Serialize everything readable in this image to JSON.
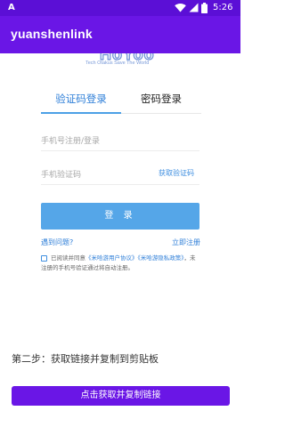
{
  "status_bar": {
    "time": "5:26",
    "left_icon": "A",
    "icons": [
      "wifi-icon",
      "signal-icon",
      "battery-icon"
    ]
  },
  "app_bar": {
    "title": "yuanshenlink"
  },
  "logo": {
    "mark": "HoYoo",
    "tagline": "Tech Otakus Save The World"
  },
  "tabs": [
    {
      "label": "验证码登录",
      "active": true
    },
    {
      "label": "密码登录",
      "active": false
    }
  ],
  "form": {
    "phone_placeholder": "手机号注册/登录",
    "code_placeholder": "手机验证码",
    "get_code_label": "获取验证码",
    "login_label": "登 录"
  },
  "links": {
    "help": "遇到问题?",
    "register": "立即注册"
  },
  "agreement": {
    "prefix": "已阅读并同意",
    "terms": "《米哈游用户协议》",
    "privacy": "《米哈游隐私政策》",
    "suffix": "，未注册的手机号验证通过将自动注册。"
  },
  "step_text": "第二步：获取链接并复制到剪贴板",
  "copy_button": "点击获取并复制链接",
  "colors": {
    "status_bar": "#5b0fd6",
    "app_bar": "#6a16e6",
    "accent_blue": "#4ba0e6",
    "login_button": "#55a6e8",
    "copy_button": "#6a16e6"
  }
}
